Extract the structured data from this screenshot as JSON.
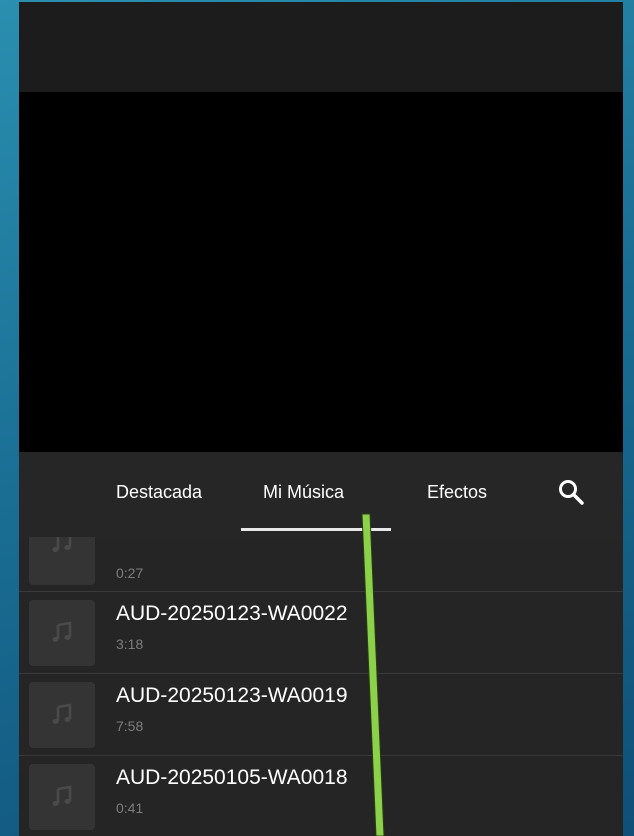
{
  "tabs": [
    {
      "label": "Destacada"
    },
    {
      "label": "Mi Música"
    },
    {
      "label": "Efectos"
    }
  ],
  "active_tab": "Mi Música",
  "songs": [
    {
      "title": "",
      "duration": "0:27"
    },
    {
      "title": "AUD-20250123-WA0022",
      "duration": "3:18"
    },
    {
      "title": "AUD-20250123-WA0019",
      "duration": "7:58"
    },
    {
      "title": "AUD-20250105-WA0018",
      "duration": "0:41"
    }
  ],
  "colors": {
    "annotation_line": "#8bd14a"
  },
  "icons": {
    "search": "search-icon",
    "thumbnail": "music-note-icon"
  }
}
